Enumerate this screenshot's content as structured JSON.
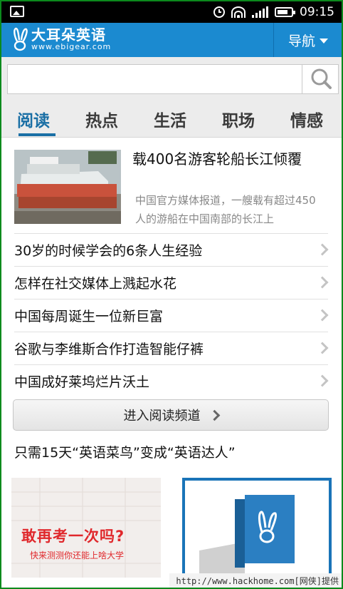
{
  "status_bar": {
    "time": "09:15"
  },
  "header": {
    "logo_title": "大耳朵英语",
    "logo_sub": "www.ebigear.com",
    "nav_label": "导航"
  },
  "search": {
    "value": "",
    "placeholder": ""
  },
  "tabs": [
    {
      "label": "阅读",
      "active": true
    },
    {
      "label": "热点",
      "active": false
    },
    {
      "label": "生活",
      "active": false
    },
    {
      "label": "职场",
      "active": false
    },
    {
      "label": "情感",
      "active": false
    }
  ],
  "featured": {
    "title": "载400名游客轮船长江倾覆",
    "description": "中国官方媒体报道，一艘载有超过450人的游船在中国南部的长江上"
  },
  "articles": [
    {
      "title": "30岁的时候学会的6条人生经验"
    },
    {
      "title": "怎样在社交媒体上溅起水花"
    },
    {
      "title": "中国每周诞生一位新巨富"
    },
    {
      "title": "谷歌与李维斯合作打造智能仔裤"
    },
    {
      "title": "中国成好莱坞烂片沃土"
    }
  ],
  "channel_button": {
    "label": "进入阅读频道"
  },
  "promo_text": "只需15天“英语菜鸟”变成“英语达人”",
  "ads": {
    "left_title": "敢再考一次吗?",
    "left_sub": "快来测测你还能上啥大学"
  },
  "watermark": "http://www.hackhome.com[网侠]提供",
  "colors": {
    "brand": "#1b8ad0",
    "tab_active": "#1a6fa5",
    "frame": "#0b8a1c"
  }
}
